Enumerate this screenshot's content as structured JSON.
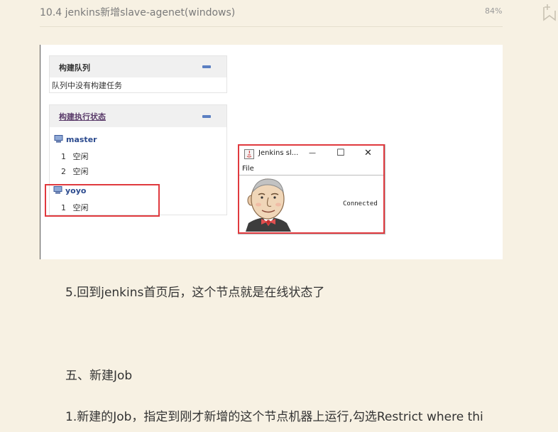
{
  "header": {
    "title": "10.4 jenkins新增slave-agenet(windows)",
    "progress": "84%"
  },
  "screenshot": {
    "build_queue": {
      "title": "构建队列",
      "empty_text": "队列中没有构建任务"
    },
    "executor_status": {
      "title": "构建执行状态",
      "nodes": [
        {
          "name": "master",
          "executors": [
            {
              "num": "1",
              "state": "空闲"
            },
            {
              "num": "2",
              "state": "空闲"
            }
          ]
        },
        {
          "name": "yoyo",
          "executors": [
            {
              "num": "1",
              "state": "空闲"
            }
          ]
        }
      ]
    },
    "slave_window": {
      "title": "Jenkins sl...",
      "menu_file": "File",
      "status": "Connected",
      "minimize": "—",
      "maximize": "☐",
      "close": "✕"
    }
  },
  "content": {
    "step5": "5.回到jenkins首页后，这个节点就是在线状态了",
    "section5": "五、新建Job",
    "step1": "1.新建的Job，指定到刚才新增的这个节点机器上运行,勾选Restrict where thi"
  },
  "colors": {
    "page_bg": "#f7f1e3",
    "highlight_red": "#e0393e",
    "jenkins_link": "#2b4a8e"
  }
}
